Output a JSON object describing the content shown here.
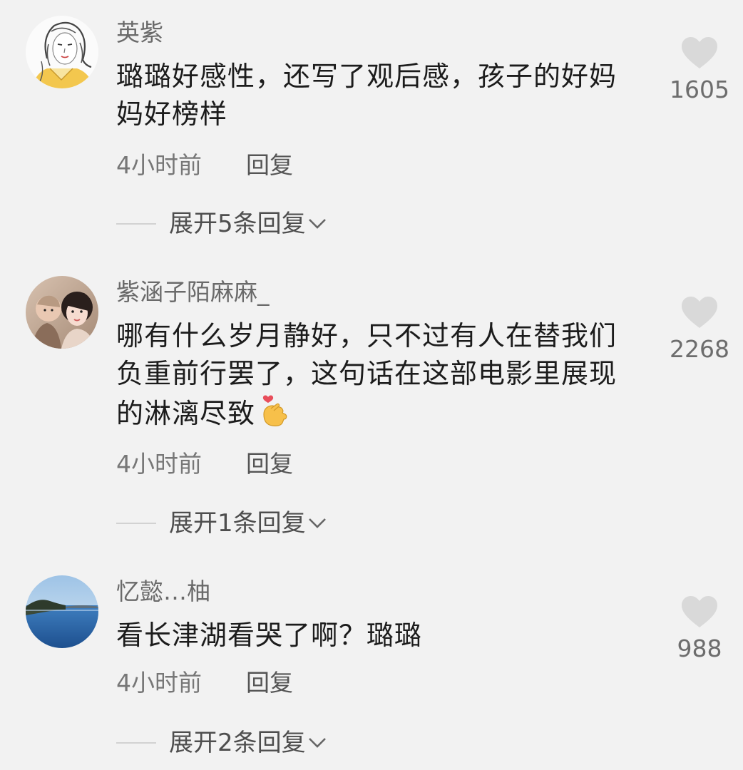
{
  "comments": [
    {
      "username": "英紫",
      "content": "璐璐好感性，还写了观后感，孩子的好妈妈好榜样",
      "time": "4小时前",
      "reply_label": "回复",
      "likes": "1605",
      "expand_label": "展开5条回复",
      "avatar_icon": "sketch-woman-avatar"
    },
    {
      "username": "紫涵子陌麻麻_",
      "content": "哪有什么岁月静好，只不过有人在替我们负重前行罢了，这句话在这部电影里展现的淋漓尽致",
      "emoji": "finger-heart-emoji",
      "time": "4小时前",
      "reply_label": "回复",
      "likes": "2268",
      "expand_label": "展开1条回复",
      "avatar_icon": "mother-child-photo-avatar"
    },
    {
      "username": "忆懿…柚",
      "content": "看长津湖看哭了啊？璐璐",
      "time": "4小时前",
      "reply_label": "回复",
      "likes": "988",
      "expand_label": "展开2条回复",
      "avatar_icon": "lake-landscape-avatar"
    }
  ],
  "colors": {
    "background": "#f2f2f2",
    "text_primary": "#1c1c1c",
    "text_secondary": "#777777",
    "heart": "#d9d9d9"
  }
}
